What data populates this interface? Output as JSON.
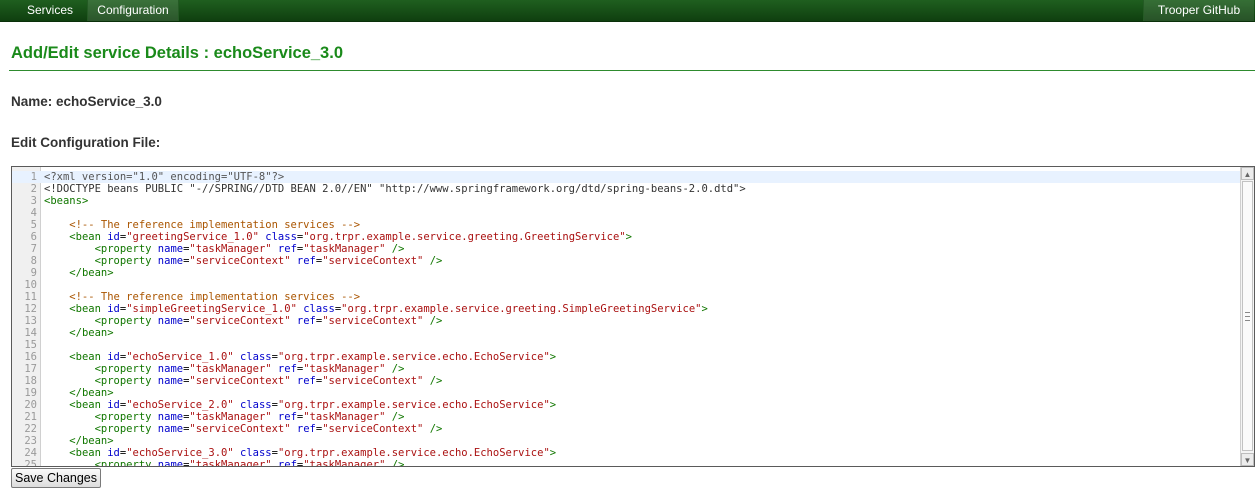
{
  "nav": {
    "services": "Services",
    "configuration": "Configuration",
    "github": "Trooper GitHub"
  },
  "page": {
    "title": "Add/Edit service Details : echoService_3.0",
    "name_line": "Name: echoService_3.0",
    "edit_label": "Edit Configuration File:"
  },
  "editor": {
    "active_line": 1,
    "lines": [
      "<?xml version=\"1.0\" encoding=\"UTF-8\"?>",
      "<!DOCTYPE beans PUBLIC \"-//SPRING//DTD BEAN 2.0//EN\" \"http://www.springframework.org/dtd/spring-beans-2.0.dtd\">",
      "<beans>",
      "",
      "    <!-- The reference implementation services -->",
      "    <bean id=\"greetingService_1.0\" class=\"org.trpr.example.service.greeting.GreetingService\">",
      "        <property name=\"taskManager\" ref=\"taskManager\" />",
      "        <property name=\"serviceContext\" ref=\"serviceContext\" />",
      "    </bean>",
      "",
      "    <!-- The reference implementation services -->",
      "    <bean id=\"simpleGreetingService_1.0\" class=\"org.trpr.example.service.greeting.SimpleGreetingService\">",
      "        <property name=\"serviceContext\" ref=\"serviceContext\" />",
      "    </bean>",
      "",
      "    <bean id=\"echoService_1.0\" class=\"org.trpr.example.service.echo.EchoService\">",
      "        <property name=\"taskManager\" ref=\"taskManager\" />",
      "        <property name=\"serviceContext\" ref=\"serviceContext\" />",
      "    </bean>",
      "    <bean id=\"echoService_2.0\" class=\"org.trpr.example.service.echo.EchoService\">",
      "        <property name=\"taskManager\" ref=\"taskManager\" />",
      "        <property name=\"serviceContext\" ref=\"serviceContext\" />",
      "    </bean>",
      "    <bean id=\"echoService_3.0\" class=\"org.trpr.example.service.echo.EchoService\">",
      "        <property name=\"taskManager\" ref=\"taskManager\" />"
    ]
  },
  "buttons": {
    "save": "Save Changes"
  },
  "colors": {
    "navbar": "#0f3f0f",
    "title": "#1a8a1a",
    "tag": "#117700",
    "attribute": "#0000cc",
    "value": "#aa1111",
    "comment": "#aa5500"
  },
  "icons": {
    "scroll_up": "scroll-up-arrow-icon",
    "scroll_down": "scroll-down-arrow-icon",
    "scroll_grip": "scroll-grip-icon"
  }
}
